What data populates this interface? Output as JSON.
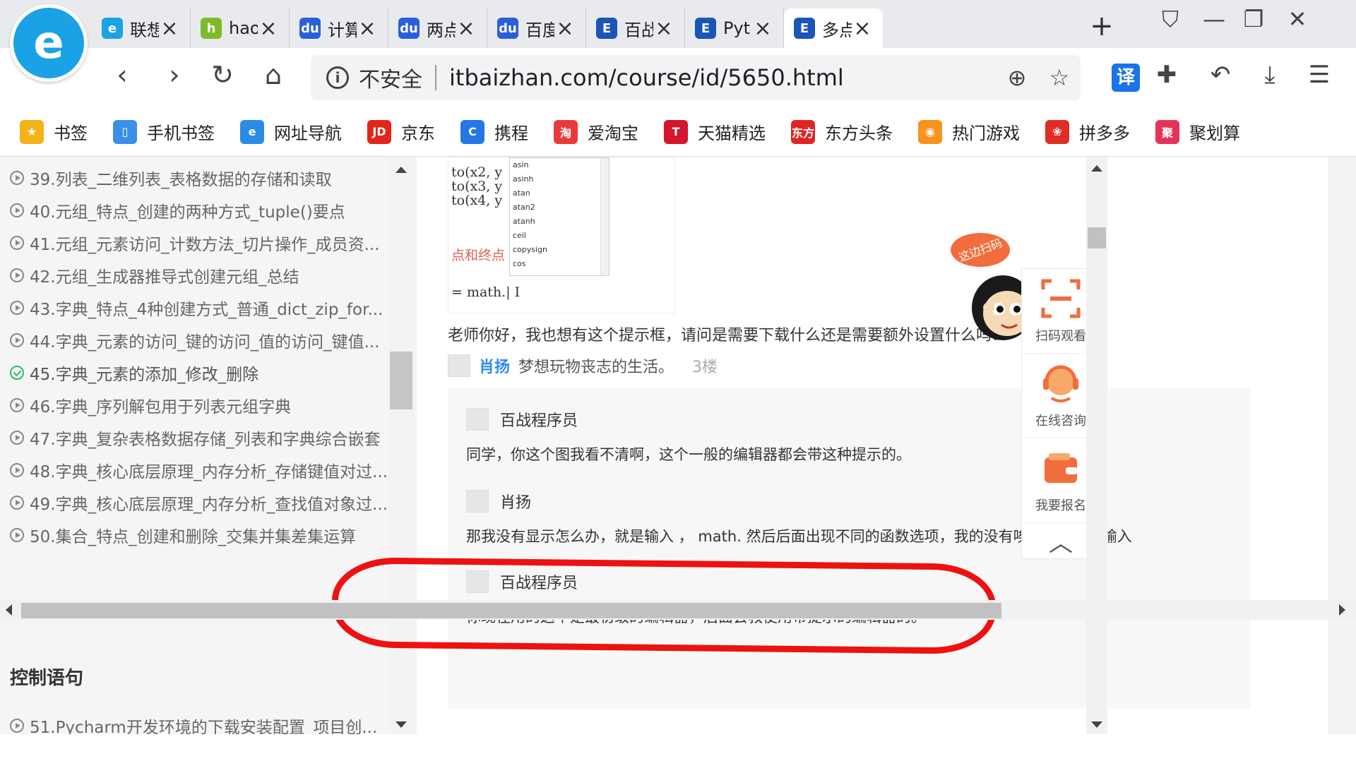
{
  "browser": {
    "tabs": [
      {
        "title": "联想",
        "icon": "e-icon",
        "color": "#1aa1e6",
        "glyph": "e"
      },
      {
        "title": "hao",
        "icon": "hao-icon",
        "color": "#7dbb2a",
        "glyph": "h"
      },
      {
        "title": "计算",
        "icon": "baidu-paw-icon",
        "color": "#2b5fd9",
        "glyph": "du"
      },
      {
        "title": "两点",
        "icon": "baidu-paw-icon",
        "color": "#2b5fd9",
        "glyph": "du"
      },
      {
        "title": "百度",
        "icon": "baidu-paw-icon",
        "color": "#2b5fd9",
        "glyph": "du"
      },
      {
        "title": "百战",
        "icon": "baizhan-icon",
        "color": "#1a56b8",
        "glyph": "E"
      },
      {
        "title": "Pyt",
        "icon": "baizhan-icon",
        "color": "#1a56b8",
        "glyph": "E"
      },
      {
        "title": "多点",
        "icon": "baizhan-icon",
        "color": "#1a56b8",
        "glyph": "E"
      }
    ],
    "security_label": "不安全",
    "url": "itbaizhan.com/course/id/5650.html",
    "translate_glyph": "译"
  },
  "bookmarks": [
    {
      "label": "书签",
      "icon": "star-icon",
      "color": "#f5b31a",
      "glyph": "★"
    },
    {
      "label": "手机书签",
      "icon": "phone-icon",
      "color": "#3b8fe8",
      "glyph": "▯"
    },
    {
      "label": "网址导航",
      "icon": "nav-icon",
      "color": "#2a8ce5",
      "glyph": "e"
    },
    {
      "label": "京东",
      "icon": "jd-icon",
      "color": "#e1251b",
      "glyph": "JD"
    },
    {
      "label": "携程",
      "icon": "ctrip-icon",
      "color": "#2577e3",
      "glyph": "C"
    },
    {
      "label": "爱淘宝",
      "icon": "taobao-icon",
      "color": "#e93b3b",
      "glyph": "淘"
    },
    {
      "label": "天猫精选",
      "icon": "tmall-icon",
      "color": "#d4152b",
      "glyph": "T"
    },
    {
      "label": "东方头条",
      "icon": "dftt-icon",
      "color": "#e02424",
      "glyph": "东方"
    },
    {
      "label": "热门游戏",
      "icon": "game-icon",
      "color": "#f7931e",
      "glyph": "◉"
    },
    {
      "label": "拼多多",
      "icon": "pdd-icon",
      "color": "#e02e24",
      "glyph": "❀"
    },
    {
      "label": "聚划算",
      "icon": "juhuasuan-icon",
      "color": "#e4335b",
      "glyph": "聚"
    }
  ],
  "sidebar": {
    "lessons": [
      {
        "title": "39.列表_二维列表_表格数据的存储和读取",
        "done": false
      },
      {
        "title": "40.元组_特点_创建的两种方式_tuple()要点",
        "done": false
      },
      {
        "title": "41.元组_元素访问_计数方法_切片操作_成员资...",
        "done": false
      },
      {
        "title": "42.元组_生成器推导式创建元组_总结",
        "done": false
      },
      {
        "title": "43.字典_特点_4种创建方式_普通_dict_zip_for...",
        "done": false
      },
      {
        "title": "44.字典_元素的访问_键的访问_值的访问_键值...",
        "done": false
      },
      {
        "title": "45.字典_元素的添加_修改_删除",
        "done": true
      },
      {
        "title": "46.字典_序列解包用于列表元组字典",
        "done": false
      },
      {
        "title": "47.字典_复杂表格数据存储_列表和字典综合嵌套",
        "done": false
      },
      {
        "title": "48.字典_核心底层原理_内存分析_存储键值对过...",
        "done": false
      },
      {
        "title": "49.字典_核心底层原理_内存分析_查找值对象过...",
        "done": false
      },
      {
        "title": "50.集合_特点_创建和删除_交集并集差集运算",
        "done": false
      }
    ],
    "chapter_title": "控制语句",
    "next_lesson": "51.Pycharm开发环境的下载安装配置_项目创..."
  },
  "question": {
    "image": {
      "code_lines": [
        "to(x2, y",
        "to(x3, y",
        "to(x4, y"
      ],
      "autocomplete": [
        "asin",
        "asinh",
        "atan",
        "atan2",
        "atanh",
        "ceil",
        "copysign",
        "cos"
      ],
      "red_text": "点和终点",
      "math_line": "= math.|  I"
    },
    "text": "老师你好，我也想有这个提示框，请问是需要下载什么还是需要额外设置什么吗?",
    "author": "肖扬",
    "author_desc": "梦想玩物丧志的生活。",
    "floor": "3楼"
  },
  "replies": [
    {
      "author": "百战程序员",
      "text": "同学，你这个图我看不清啊，这个一般的编辑器都会带这种提示的。"
    },
    {
      "author": "肖扬",
      "text": "那我没有显示怎么办，就是输入 ，  math.      然后后面出现不同的函数选项，我的没有唉，都得自己输入"
    },
    {
      "author": "百战程序员",
      "text": "你现在用的这个是最初级的编辑器，后面会教使用带提示的编辑器的。"
    }
  ],
  "float_panel": {
    "mascot_badge": "这边扫码",
    "scan_label": "扫码观看",
    "consult_label": "在线咨询",
    "signup_label": "我要报名"
  },
  "colors": {
    "accent_blue": "#2d8cf0",
    "float_orange": "#f26d3d",
    "annotation_red": "#ee1111"
  }
}
